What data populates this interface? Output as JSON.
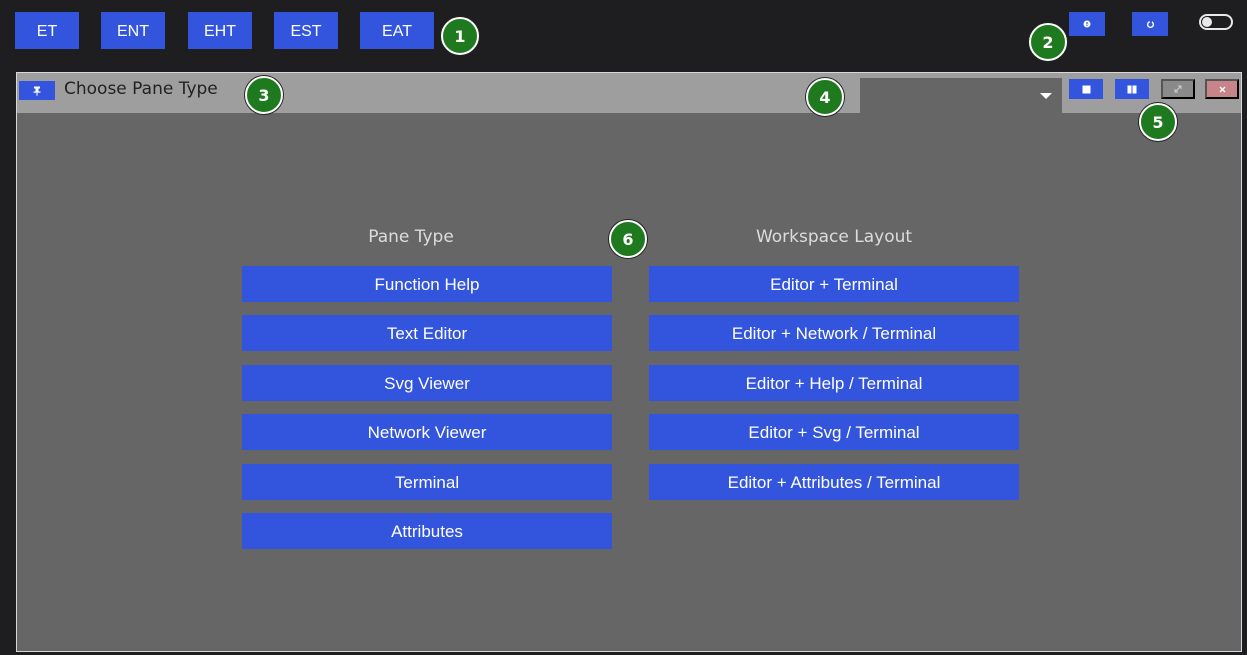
{
  "toolbar": {
    "layouts": [
      "ET",
      "ENT",
      "EHT",
      "EST",
      "EAT"
    ]
  },
  "pane": {
    "title": "Choose Pane Type",
    "select": {
      "value": ""
    }
  },
  "pane_types": {
    "heading": "Pane Type",
    "items": [
      "Function Help",
      "Text Editor",
      "Svg Viewer",
      "Network Viewer",
      "Terminal",
      "Attributes"
    ]
  },
  "workspace_layouts": {
    "heading": "Workspace Layout",
    "items": [
      "Editor + Terminal",
      "Editor + Network / Terminal",
      "Editor + Help / Terminal",
      "Editor + Svg / Terminal",
      "Editor + Attributes / Terminal"
    ]
  },
  "badges": [
    "1",
    "2",
    "3",
    "4",
    "5",
    "6"
  ],
  "icons": {
    "help": "question-icon",
    "refresh": "refresh-icon",
    "theme_toggle": "toggle-switch",
    "pin": "pin-icon",
    "dropdown": "caret-down-icon",
    "single_pane": "square-icon",
    "split_pane": "split-square-icon",
    "maximize": "expand-icon",
    "close": "close-icon"
  },
  "colors": {
    "accent": "#3355dd",
    "background": "#1e1e20",
    "pane_body": "#666666",
    "pane_header": "#9e9e9e",
    "badge": "#1f7a1f",
    "close_disabled": "#c7858a"
  }
}
